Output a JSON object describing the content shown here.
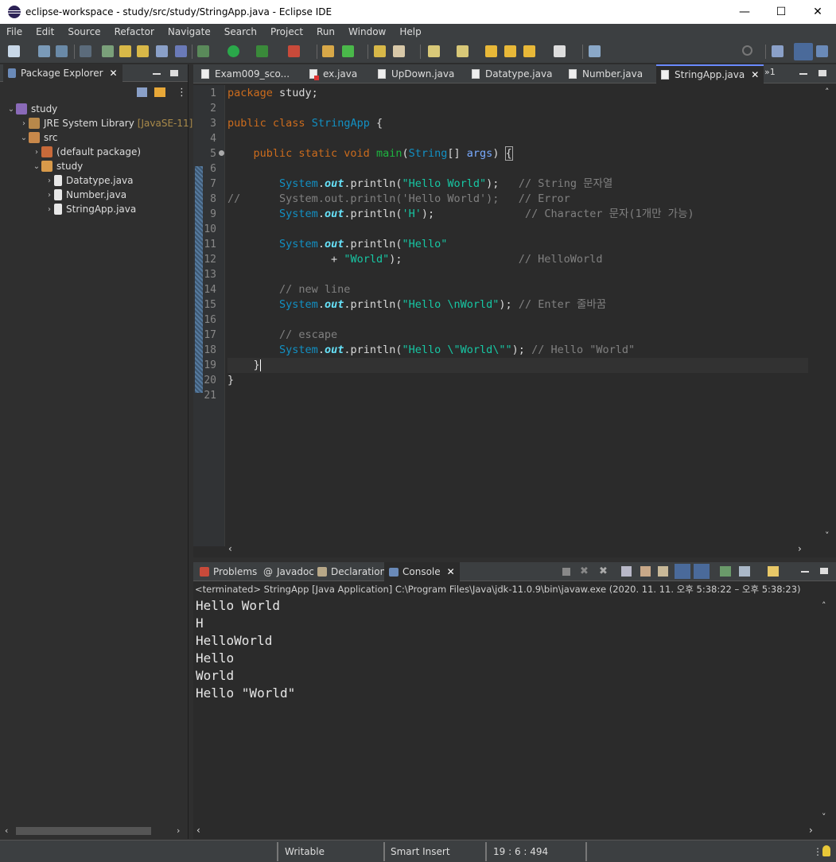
{
  "window": {
    "title": "eclipse-workspace - study/src/study/StringApp.java - Eclipse IDE",
    "minimize": "—",
    "maximize": "☐",
    "close": "✕"
  },
  "menu": {
    "items": [
      "File",
      "Edit",
      "Source",
      "Refactor",
      "Navigate",
      "Search",
      "Project",
      "Run",
      "Window",
      "Help"
    ]
  },
  "package_explorer": {
    "tab_label": "Package Explorer",
    "tree": [
      {
        "label": "study",
        "level": 0,
        "icon": "project-icon"
      },
      {
        "label": "JRE System Library",
        "suffix": "[JavaSE-11]",
        "level": 1,
        "icon": "library-icon"
      },
      {
        "label": "src",
        "level": 1,
        "icon": "source-folder-icon"
      },
      {
        "label": "(default package)",
        "level": 2,
        "icon": "package-icon"
      },
      {
        "label": "study",
        "level": 2,
        "icon": "package-icon"
      },
      {
        "label": "Datatype.java",
        "level": 3,
        "icon": "java-file-icon"
      },
      {
        "label": "Number.java",
        "level": 3,
        "icon": "java-file-icon"
      },
      {
        "label": "StringApp.java",
        "level": 3,
        "icon": "java-file-icon"
      }
    ]
  },
  "editor": {
    "tabs": [
      {
        "label": "Exam009_sco...",
        "error": false
      },
      {
        "label": "ex.java",
        "error": true
      },
      {
        "label": "UpDown.java",
        "error": false
      },
      {
        "label": "Datatype.java",
        "error": false
      },
      {
        "label": "Number.java",
        "error": false
      },
      {
        "label": "StringApp.java",
        "error": false,
        "active": true
      }
    ],
    "overflow_label": "»1",
    "line_numbers": [
      "1",
      "2",
      "3",
      "4",
      "5",
      "6",
      "7",
      "8",
      "9",
      "10",
      "11",
      "12",
      "13",
      "14",
      "15",
      "16",
      "17",
      "18",
      "19",
      "20",
      "21"
    ],
    "code": {
      "l1_kw": "package",
      "l1_rest": " study;",
      "l3_kw1": "public",
      "l3_kw2": " class",
      "l3_cls": " StringApp",
      "l3_rest": " {",
      "l5_kw": "public static void",
      "l5_fn": "main",
      "l5_p1": "(",
      "l5_cls": "String",
      "l5_p2": "[] ",
      "l5_arg": "args",
      "l5_p3": ") ",
      "l5_brace": "{",
      "sys": "System",
      "dot": ".",
      "out": "out",
      "println": ".println(",
      "l7_str": "\"Hello World\"",
      "l7_end": ");   ",
      "l7_cm": "// String 문자열",
      "l8_cm": "//      System.out.println('Hello World');   // Error",
      "l9_str": "'H'",
      "l9_end": ");              ",
      "l9_cm": "// Character 문자(1개만 가능)",
      "l11_str": "\"Hello\"",
      "l12_plus": "+ ",
      "l12_str": "\"World\"",
      "l12_end": ");                  ",
      "l12_cm": "// HelloWorld",
      "l14_cm": "// new line",
      "l15_str": "\"Hello \\nWorld\"",
      "l15_end": "); ",
      "l15_cm": "// Enter 줄바꿈",
      "l17_cm": "// escape",
      "l18_str": "\"Hello \\\"World\\\"\"",
      "l18_end": "); ",
      "l18_cm": "// Hello \"World\"",
      "l19": "}",
      "l20": "}"
    }
  },
  "console": {
    "tabs": [
      "Problems",
      "Javadoc",
      "Declaration",
      "Console"
    ],
    "header": "<terminated> StringApp [Java Application] C:\\Program Files\\Java\\jdk-11.0.9\\bin\\javaw.exe  (2020. 11. 11. 오후 5:38:22 – 오후 5:38:23)",
    "output": [
      "Hello World",
      "H",
      "HelloWorld",
      "Hello",
      "World",
      "Hello \"World\""
    ]
  },
  "statusbar": {
    "writable": "Writable",
    "insert_mode": "Smart Insert",
    "position": "19 : 6 : 494"
  }
}
